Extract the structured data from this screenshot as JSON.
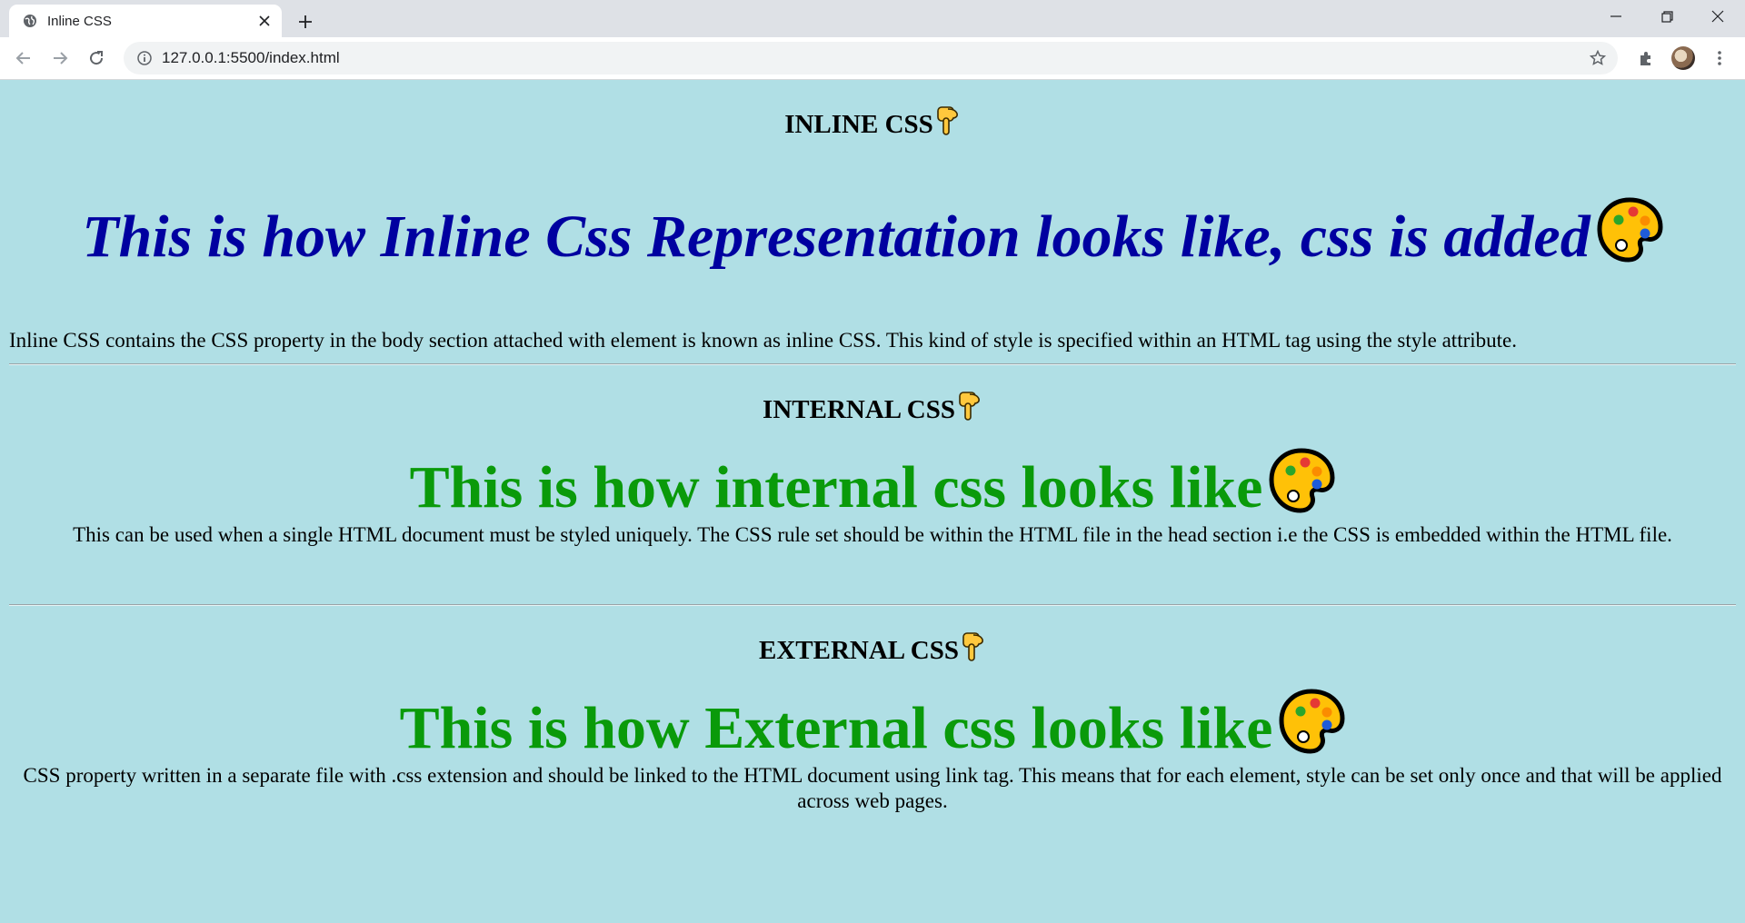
{
  "browser": {
    "tab_title": "Inline CSS",
    "url": "127.0.0.1:5500/index.html"
  },
  "sections": {
    "inline": {
      "heading": "INLINE CSS",
      "headline": "This is how Inline Css Representation looks like, css is added",
      "paragraph": "Inline CSS contains the CSS property in the body section attached with element is known as inline CSS. This kind of style is specified within an HTML tag using the style attribute.",
      "headline_color": "#0000a0"
    },
    "internal": {
      "heading": "INTERNAL CSS",
      "headline": "This is how internal css looks like",
      "paragraph": "This can be used when a single HTML document must be styled uniquely. The CSS rule set should be within the HTML file in the head section i.e the CSS is embedded within the HTML file.",
      "headline_color": "#0a9a0a"
    },
    "external": {
      "heading": "EXTERNAL CSS",
      "headline": "This is how External css looks like",
      "paragraph": "CSS property written in a separate file with .css extension and should be linked to the HTML document using link tag. This means that for each element, style can be set only once and that will be applied across web pages.",
      "headline_color": "#0a9a0a"
    }
  },
  "colors": {
    "page_background": "#b0dfe5"
  },
  "icons": {
    "heading_emoji": "pointing-down-hand-icon",
    "headline_emoji": "artist-palette-icon"
  }
}
